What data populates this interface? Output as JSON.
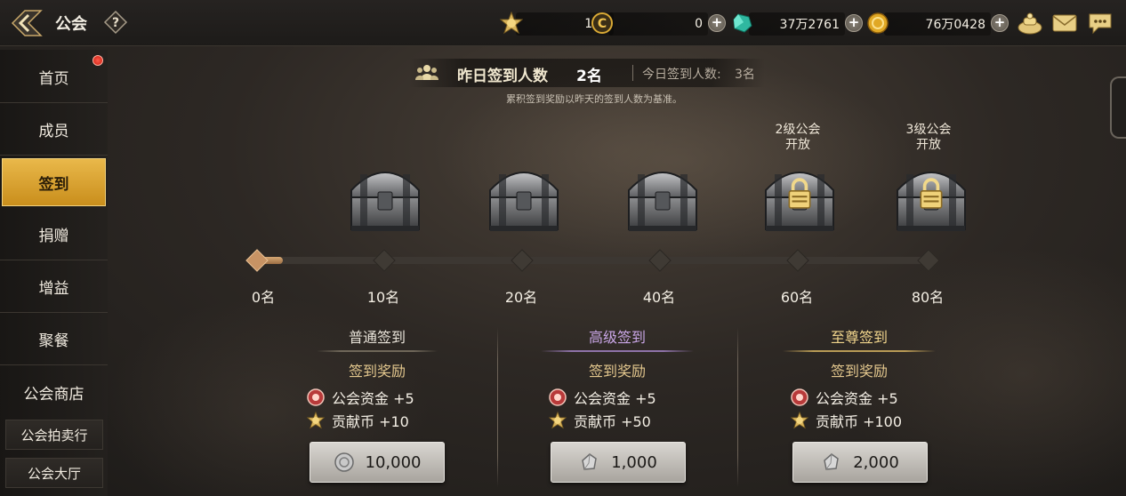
{
  "header": {
    "title": "公会",
    "resources": [
      {
        "icon": "contribution-coin-icon",
        "value": "100"
      },
      {
        "icon": "c-coin-icon",
        "value": "0"
      },
      {
        "icon": "green-gem-icon",
        "value": "37万2761"
      },
      {
        "icon": "gold-coin-icon",
        "value": "76万0428"
      }
    ]
  },
  "sidebar": {
    "items": [
      {
        "label": "首页"
      },
      {
        "label": "成员"
      },
      {
        "label": "签到"
      },
      {
        "label": "捐赠"
      },
      {
        "label": "增益"
      },
      {
        "label": "聚餐"
      },
      {
        "label": "公会商店"
      },
      {
        "label": "公会拍卖行"
      },
      {
        "label": "公会大厅"
      }
    ]
  },
  "checkin": {
    "yesterday_label": "昨日签到人数",
    "yesterday_value": "2名",
    "today_label": "今日签到人数:",
    "today_value": "3名",
    "note": "累积签到奖励以昨天的签到人数为基准。",
    "progress": {
      "current": 2,
      "max": 80
    },
    "milestones": [
      {
        "label": "0名",
        "value": 0
      },
      {
        "label": "10名",
        "value": 10
      },
      {
        "label": "20名",
        "value": 20
      },
      {
        "label": "40名",
        "value": 40
      },
      {
        "label": "60名",
        "value": 60
      },
      {
        "label": "80名",
        "value": 80
      }
    ],
    "chests": [
      {
        "locked": false
      },
      {
        "locked": false
      },
      {
        "locked": false
      },
      {
        "locked": true,
        "note_line1": "2级公会",
        "note_line2": "开放"
      },
      {
        "locked": true,
        "note_line1": "3级公会",
        "note_line2": "开放"
      }
    ]
  },
  "tiers": [
    {
      "title": "普通签到",
      "title_color": "#e8e3d9",
      "line_color": "#6f6759",
      "reward_header": "签到奖励",
      "rewards": [
        {
          "icon": "guild-fund-icon",
          "text": "公会资金 +5"
        },
        {
          "icon": "contribution-coin-icon",
          "text": "贡献币 +10"
        }
      ],
      "cost_icon": "silver-coin-icon",
      "cost": "10,000"
    },
    {
      "title": "高级签到",
      "title_color": "#c9a6e6",
      "line_color": "#8e72a8",
      "reward_header": "签到奖励",
      "rewards": [
        {
          "icon": "guild-fund-icon",
          "text": "公会资金 +5"
        },
        {
          "icon": "contribution-coin-icon",
          "text": "贡献币 +50"
        }
      ],
      "cost_icon": "crystal-icon",
      "cost": "1,000"
    },
    {
      "title": "至尊签到",
      "title_color": "#f1d58c",
      "line_color": "#b89a55",
      "reward_header": "签到奖励",
      "rewards": [
        {
          "icon": "guild-fund-icon",
          "text": "公会资金 +5"
        },
        {
          "icon": "contribution-coin-icon",
          "text": "贡献币 +100"
        }
      ],
      "cost_icon": "crystal-icon",
      "cost": "2,000"
    }
  ]
}
